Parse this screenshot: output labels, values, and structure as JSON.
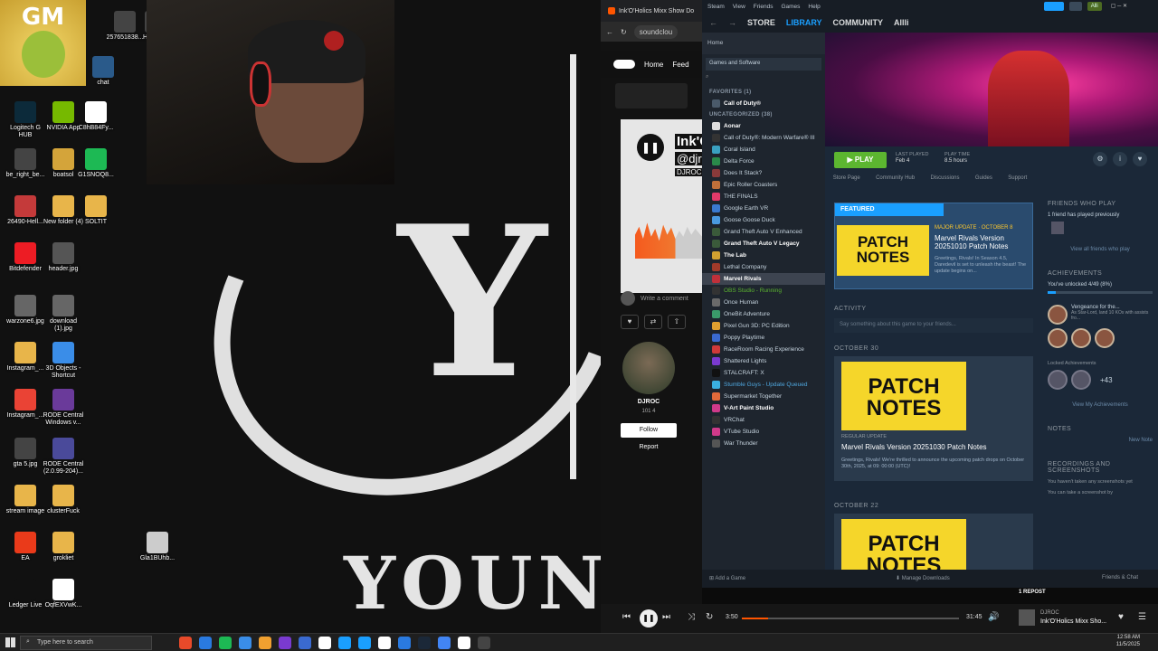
{
  "desktop": {
    "icons": [
      {
        "label": "Logitech G HUB",
        "color": "#0c2a3a"
      },
      {
        "label": "NVIDIA App",
        "color": "#76b900"
      },
      {
        "label": "C8hB84Fy...",
        "color": "#ffffff"
      },
      {
        "label": "be_right_be...",
        "color": "#444444"
      },
      {
        "label": "boatsol",
        "color": "#d4a43a"
      },
      {
        "label": "G1SNOQ8...",
        "color": "#1db954"
      },
      {
        "label": "26490-Hell...",
        "color": "#c43a3a"
      },
      {
        "label": "New folder (4)",
        "color": "#e8b54a"
      },
      {
        "label": "SOLTIT",
        "color": "#e8b54a"
      },
      {
        "label": "Bitdefender",
        "color": "#ed1c24"
      },
      {
        "label": "header.jpg",
        "color": "#555555"
      },
      {
        "label": "warzone6.jpg",
        "color": "#666666"
      },
      {
        "label": "download (1).jpg",
        "color": "#666666"
      },
      {
        "label": "Instagram_...",
        "color": "#e8b54a"
      },
      {
        "label": "3D Objects - Shortcut",
        "color": "#3a8de8"
      },
      {
        "label": "Instagram_...",
        "color": "#ea4335"
      },
      {
        "label": "RODE Central Windows v...",
        "color": "#6a3a9a"
      },
      {
        "label": "gta 5.jpg",
        "color": "#444444"
      },
      {
        "label": "RODE Central (2.0.99-204)...",
        "color": "#4a4a9a"
      },
      {
        "label": "stream image",
        "color": "#e8b54a"
      },
      {
        "label": "clusterFuck",
        "color": "#e8b54a"
      },
      {
        "label": "EA",
        "color": "#ea3a1a"
      },
      {
        "label": "grokliet",
        "color": "#e8b54a"
      },
      {
        "label": "Ledger Live",
        "color": "#111111"
      },
      {
        "label": "OqfEXVwK...",
        "color": "#ffffff"
      },
      {
        "label": "Gla1BUhb...",
        "color": "#cccccc"
      },
      {
        "label": "257651838...",
        "color": "#444444"
      },
      {
        "label": "Hi... Troy",
        "color": "#444444"
      },
      {
        "label": "chat",
        "color": "#2a5a8a"
      },
      {
        "label": "dtcu98d43...",
        "color": "#333333"
      }
    ],
    "overlay_logo": "GM",
    "wallpaper_text": {
      "big_letter": "Y",
      "word": "YOUNG"
    }
  },
  "soundcloud": {
    "tab_title": "Ink'O'Holics Mixx Show Do",
    "url": "soundclou",
    "nav": [
      "Home",
      "Feed"
    ],
    "track_title": "Ink'O",
    "track_handle": "@djro",
    "track_artist": "DJROC",
    "comment_placeholder": "Write a comment",
    "profile_name": "DJROC",
    "profile_stats": "101   4",
    "follow_label": "Follow",
    "report_label": "Report"
  },
  "player": {
    "elapsed": "3:50",
    "total": "31:45",
    "progress": 0.12,
    "repost_label": "1 REPOST",
    "now_artist": "DJROC",
    "now_title": "Ink'O'Holics Mixx Sho..."
  },
  "steam": {
    "menu": [
      "Steam",
      "View",
      "Friends",
      "Games",
      "Help"
    ],
    "account": "Alli",
    "tabs": [
      "STORE",
      "LIBRARY",
      "COMMUNITY",
      "Allli"
    ],
    "active_tab": "LIBRARY",
    "home_label": "Home",
    "filter_label": "Games and Software",
    "favorites_header": "FAVORITES",
    "favorites_count": "(1)",
    "favorites": [
      {
        "name": "Call of Duty®",
        "color": "#4a5a6a",
        "bold": true
      }
    ],
    "uncategorized_header": "UNCATEGORIZED",
    "uncategorized_count": "(38)",
    "games": [
      {
        "name": "Aonar",
        "color": "#dddddd",
        "bold": true
      },
      {
        "name": "Call of Duty®: Modern Warfare® III",
        "color": "#333333",
        "bold": false
      },
      {
        "name": "Coral Island",
        "color": "#3aa0c0",
        "bold": false
      },
      {
        "name": "Delta Force",
        "color": "#2a8a4a",
        "bold": false
      },
      {
        "name": "Does It Stack?",
        "color": "#8a3a3a",
        "bold": false
      },
      {
        "name": "Epic Roller Coasters",
        "color": "#c0703a",
        "bold": false
      },
      {
        "name": "THE FINALS",
        "color": "#e03a6a",
        "bold": false
      },
      {
        "name": "Google Earth VR",
        "color": "#3a7ad0",
        "bold": false
      },
      {
        "name": "Goose Goose Duck",
        "color": "#4a9ae0",
        "bold": false
      },
      {
        "name": "Grand Theft Auto V Enhanced",
        "color": "#3a5a3a",
        "bold": false
      },
      {
        "name": "Grand Theft Auto V Legacy",
        "color": "#3a5a3a",
        "bold": true
      },
      {
        "name": "The Lab",
        "color": "#d0a030",
        "bold": true
      },
      {
        "name": "Lethal Company",
        "color": "#a03a2a",
        "bold": false
      },
      {
        "name": "Marvel Rivals",
        "color": "#c0303a",
        "bold": true
      },
      {
        "name": "OBS Studio - Running",
        "color": "#333333",
        "bold": false
      },
      {
        "name": "Once Human",
        "color": "#6a6a6a",
        "bold": false
      },
      {
        "name": "OneBit Adventure",
        "color": "#3a9a6a",
        "bold": false
      },
      {
        "name": "Pixel Gun 3D: PC Edition",
        "color": "#e0a030",
        "bold": false
      },
      {
        "name": "Poppy Playtime",
        "color": "#3a6ad0",
        "bold": false
      },
      {
        "name": "RaceRoom Racing Experience",
        "color": "#d03a3a",
        "bold": false
      },
      {
        "name": "Shattered Lights",
        "color": "#7a3ad0",
        "bold": false
      },
      {
        "name": "STALCRAFT: X",
        "color": "#111111",
        "bold": false
      },
      {
        "name": "Stumble Guys - Update Queued",
        "color": "#3ab0e0",
        "bold": false
      },
      {
        "name": "Supermarket Together",
        "color": "#e06a3a",
        "bold": false
      },
      {
        "name": "V-Art Paint Studio",
        "color": "#d03a8a",
        "bold": true
      },
      {
        "name": "VRChat",
        "color": "#333333",
        "bold": false
      },
      {
        "name": "VTube Studio",
        "color": "#d03a8a",
        "bold": false
      },
      {
        "name": "War Thunder",
        "color": "#555555",
        "bold": false
      }
    ],
    "selected_game": "Marvel Rivals",
    "play_label": "PLAY",
    "last_played_label": "LAST PLAYED",
    "last_played_value": "Feb 4",
    "play_time_label": "PLAY TIME",
    "play_time_value": "8.5 hours",
    "subnav": [
      "Store Page",
      "Community Hub",
      "Discussions",
      "Guides",
      "Support"
    ],
    "featured": {
      "header": "FEATURED",
      "tag": "MAJOR UPDATE · OCTOBER 8",
      "title": "Marvel Rivals Version 20251010 Patch Notes",
      "desc": "Greetings, Rivals! In Season 4.5, Daredevil is set to unleash the beast! The update begins on...",
      "thumb": "PATCH NOTES"
    },
    "activity_label": "ACTIVITY",
    "say_placeholder": "Say something about this game to your friends...",
    "dates": [
      "OCTOBER 30",
      "OCTOBER 22"
    ],
    "news": [
      {
        "thumb": "PATCH NOTES",
        "type": "REGULAR UPDATE",
        "title": "Marvel Rivals Version 20251030 Patch Notes",
        "desc": "Greetings, Rivals! We're thrilled to announce the upcoming patch drops on October 30th, 2025, at 09: 00:00 (UTC)!"
      },
      {
        "thumb": "PATCH NOTES",
        "type": "",
        "title": "",
        "desc": ""
      }
    ],
    "friends": {
      "header": "FRIENDS WHO PLAY",
      "text": "1 friend has played previously",
      "link": "View all friends who play"
    },
    "achievements": {
      "header": "ACHIEVEMENTS",
      "unlocked": "You've unlocked 4/49 (8%)",
      "progress": 0.08,
      "featured_name": "Vengeance for the...",
      "featured_desc": "As Star-Lord, land 10 KOs with assists fro...",
      "locked_label": "Locked Achievements",
      "more": "+43",
      "link": "View My Achievements"
    },
    "notes": {
      "header": "NOTES",
      "link": "New Note"
    },
    "recordings": {
      "header": "RECORDINGS AND SCREENSHOTS",
      "text1": "You haven't taken any screenshots yet",
      "text2": "You can take a screenshot by"
    },
    "footer": {
      "add_game": "Add a Game",
      "downloads": "Manage Downloads",
      "friends": "Friends & Chat"
    }
  },
  "taskbar": {
    "search_placeholder": "Type here to search",
    "time": "12:58 AM",
    "date": "11/5/2025",
    "apps": [
      "#e84a2a",
      "#2a7ae0",
      "#1db954",
      "#3a8de8",
      "#f0a030",
      "#7a3ad0",
      "#3a6ad0",
      "#ffffff",
      "#1a9fff",
      "#1a9fff",
      "#ffffff",
      "#2a7ae0",
      "#1b2838",
      "#4285f4",
      "#ffffff",
      "#444444"
    ]
  }
}
